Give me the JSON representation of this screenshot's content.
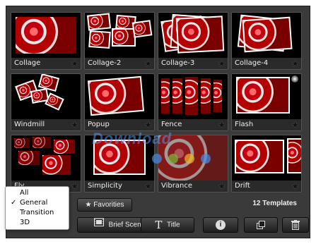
{
  "templates": [
    {
      "name": "Collage"
    },
    {
      "name": "Collage-2"
    },
    {
      "name": "Collage-3"
    },
    {
      "name": "Collage-4"
    },
    {
      "name": "Windmill"
    },
    {
      "name": "Popup"
    },
    {
      "name": "Fence"
    },
    {
      "name": "Flash"
    },
    {
      "name": "Fly"
    },
    {
      "name": "Simplicity"
    },
    {
      "name": "Vibrance"
    },
    {
      "name": "Drift"
    }
  ],
  "statusbar": {
    "favorites_label": "Favorities",
    "count_label": "12 Templates"
  },
  "filter_menu": {
    "items": [
      "All",
      "General",
      "Transition",
      "3D"
    ],
    "selected": "General"
  },
  "toolbar": {
    "brief_scene_label": "Brief Scene",
    "title_label": "Title"
  },
  "watermark": "Download",
  "colors": {
    "panel": "#3a3a3a",
    "tile_label_bg": "#2a2a2a",
    "menu_bg": "#ffffff"
  }
}
